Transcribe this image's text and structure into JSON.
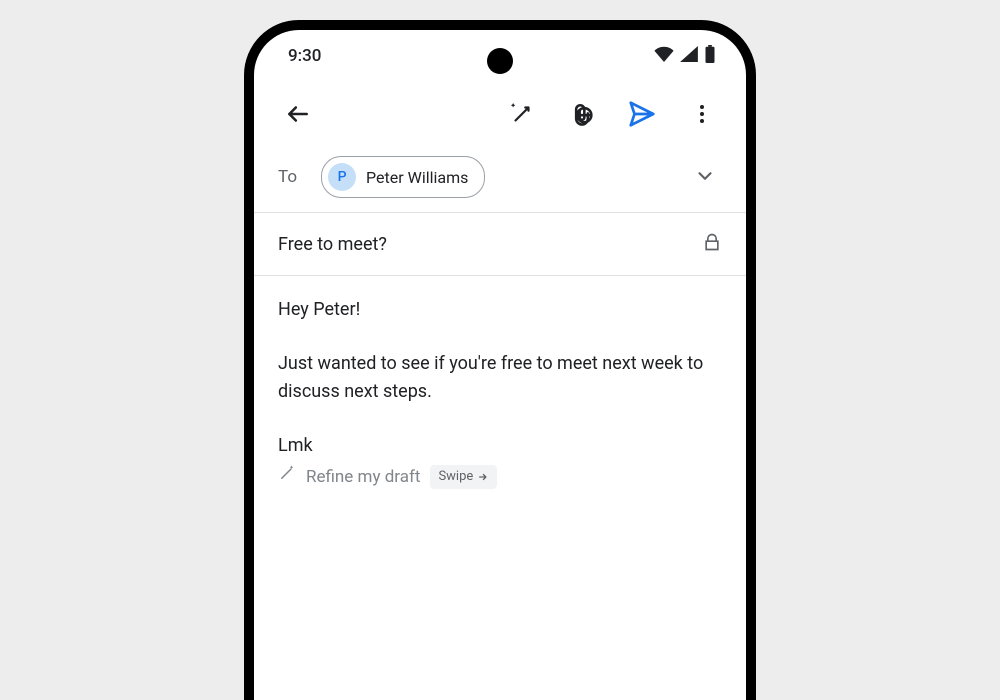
{
  "status_bar": {
    "time": "9:30"
  },
  "compose": {
    "to_label": "To",
    "recipient_initial": "P",
    "recipient_name": "Peter Williams",
    "subject": "Free to meet?",
    "body_line1": "Hey Peter!",
    "body_line2": "Just wanted to see if you're free to meet next week to discuss next steps.",
    "body_line3": "Lmk"
  },
  "refine": {
    "label": "Refine my draft",
    "swipe_label": "Swipe"
  }
}
